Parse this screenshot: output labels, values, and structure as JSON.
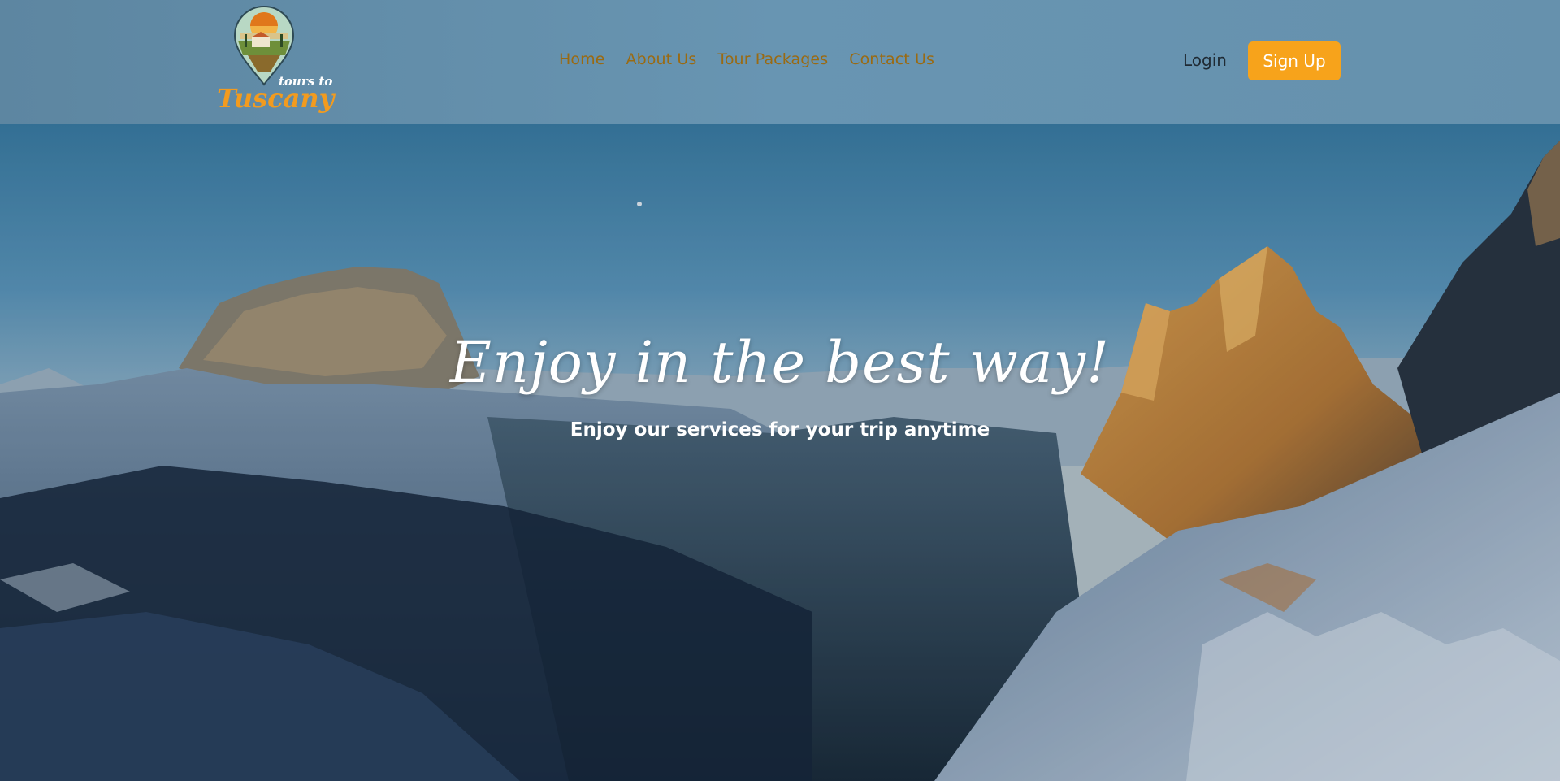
{
  "logo": {
    "line1": "tours to",
    "line2": "Tuscany"
  },
  "nav": [
    {
      "label": "Home"
    },
    {
      "label": "About Us"
    },
    {
      "label": "Tour Packages"
    },
    {
      "label": "Contact Us"
    }
  ],
  "auth": {
    "login": "Login",
    "signup": "Sign Up"
  },
  "hero": {
    "title": "Enjoy in the best way!",
    "subtitle": "Enjoy our services for your trip anytime"
  },
  "colors": {
    "accent": "#f7a31b",
    "nav_link": "#9a6a12",
    "header_bg": "#6691ad"
  }
}
